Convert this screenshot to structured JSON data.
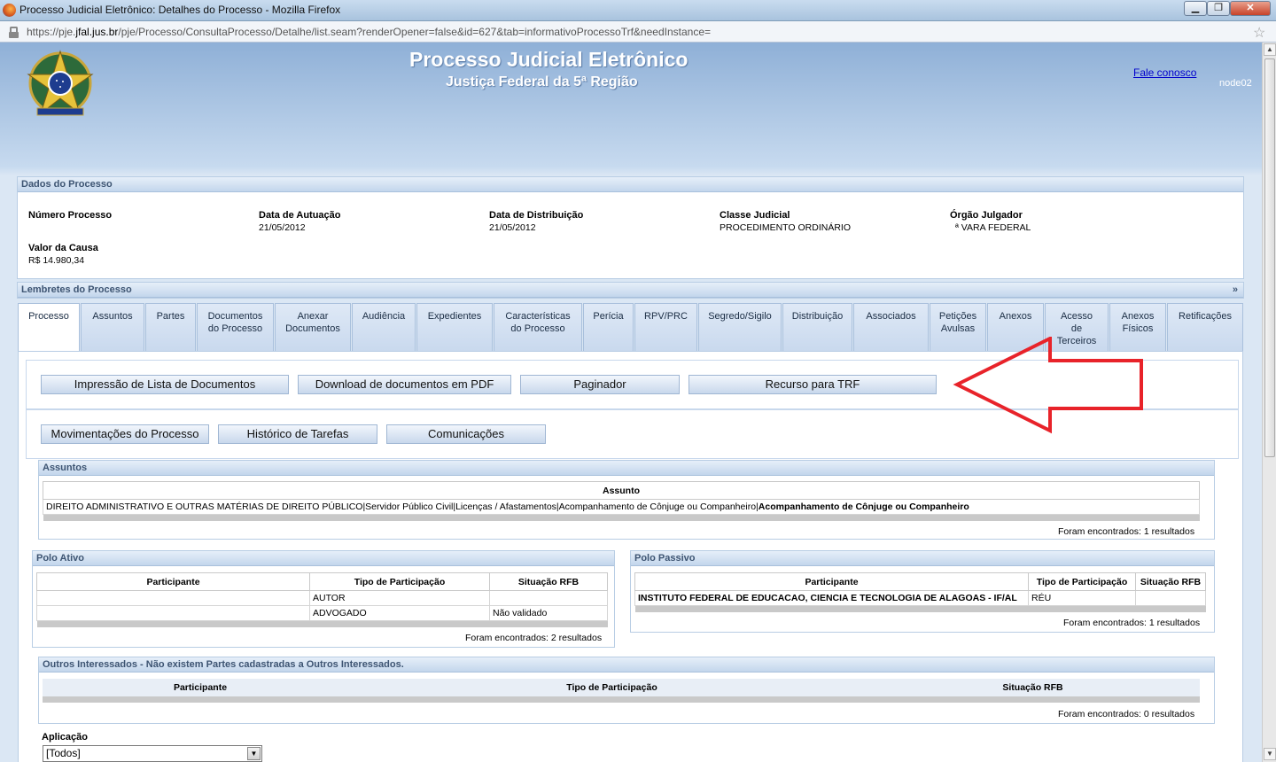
{
  "window": {
    "title": "Processo Judicial Eletrônico: Detalhes do Processo - Mozilla Firefox"
  },
  "urlbar": {
    "prefix": "https://pje.",
    "domain": "jfal.jus.br",
    "rest": "/pje/Processo/ConsultaProcesso/Detalhe/list.seam?renderOpener=false&id=627&tab=informativoProcessoTrf&needInstance="
  },
  "header": {
    "title": "Processo Judicial Eletrônico",
    "subtitle": "Justiça Federal da 5ª Região",
    "contact_link": "Fale conosco",
    "node": "node02"
  },
  "dados": {
    "heading": "Dados do Processo",
    "fields": [
      {
        "label": "Número Processo",
        "value": ""
      },
      {
        "label": "Data de Autuação",
        "value": "21/05/2012"
      },
      {
        "label": "Data de Distribuição",
        "value": "21/05/2012"
      },
      {
        "label": "Classe Judicial",
        "value": "PROCEDIMENTO ORDINÁRIO"
      },
      {
        "label": "Órgão Julgador",
        "value": "ª VARA FEDERAL"
      },
      {
        "label": "Valor da Causa",
        "value": "R$ 14.980,34"
      }
    ]
  },
  "lembretes": {
    "heading": "Lembretes do Processo",
    "toggle": "»"
  },
  "tabs": [
    "Processo",
    "Assuntos",
    "Partes",
    "Documentos do Processo",
    "Anexar Documentos",
    "Audiência",
    "Expedientes",
    "Características do Processo",
    "Perícia",
    "RPV/PRC",
    "Segredo/Sigilo",
    "Distribuição",
    "Associados",
    "Petições Avulsas",
    "Anexos",
    "Acesso de Terceiros",
    "Anexos Físicos",
    "Retificações"
  ],
  "actions_row1": [
    "Impressão de Lista de Documentos",
    "Download de documentos em PDF",
    "Paginador",
    "Recurso para TRF"
  ],
  "actions_row2": [
    "Movimentações do Processo",
    "Histórico de Tarefas",
    "Comunicações"
  ],
  "assuntos": {
    "heading": "Assuntos",
    "column": "Assunto",
    "row_plain": "DIREITO ADMINISTRATIVO E OUTRAS MATÉRIAS DE DIREITO PÚBLICO|Servidor Público Civil|Licenças / Afastamentos|Acompanhamento de Cônjuge ou Companheiro|",
    "row_bold": "Acompanhamento de Cônjuge ou Companheiro",
    "found": "Foram encontrados: 1 resultados"
  },
  "polo_ativo": {
    "heading": "Polo Ativo",
    "columns": [
      "Participante",
      "Tipo de Participação",
      "Situação RFB"
    ],
    "rows": [
      [
        "",
        "AUTOR",
        ""
      ],
      [
        "",
        "ADVOGADO",
        "Não validado"
      ]
    ],
    "found": "Foram encontrados: 2 resultados"
  },
  "polo_passivo": {
    "heading": "Polo Passivo",
    "columns": [
      "Participante",
      "Tipo de Participação",
      "Situação RFB"
    ],
    "rows": [
      [
        "INSTITUTO FEDERAL DE EDUCACAO, CIENCIA E TECNOLOGIA DE ALAGOAS - IF/AL",
        "RÉU",
        ""
      ]
    ],
    "found": "Foram encontrados: 1 resultados"
  },
  "outros": {
    "heading": "Outros Interessados - Não existem Partes cadastradas a Outros Interessados.",
    "columns": [
      "Participante",
      "Tipo de Participação",
      "Situação RFB"
    ],
    "found": "Foram encontrados: 0 resultados"
  },
  "aplicacao": {
    "label": "Aplicação",
    "value": "[Todos]"
  },
  "annotation": {
    "color": "#e8232a"
  }
}
